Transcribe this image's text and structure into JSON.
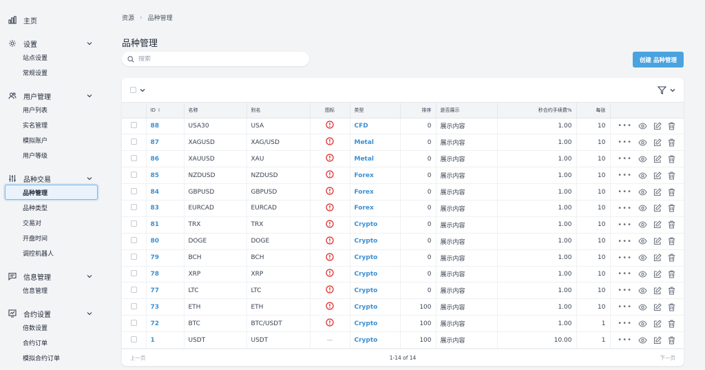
{
  "sidebar": {
    "home": "主页",
    "sections": [
      {
        "label": "设置",
        "items": [
          "站点设置",
          "常规设置"
        ]
      },
      {
        "label": "用户管理",
        "items": [
          "用户列表",
          "实名管理",
          "模拟账户",
          "用户等级"
        ]
      },
      {
        "label": "品种交易",
        "items": [
          "品种管理",
          "品种类型",
          "交易对",
          "开盘时间",
          "调控机器人"
        ]
      },
      {
        "label": "信息管理",
        "items": [
          "信息管理"
        ]
      },
      {
        "label": "合约设置",
        "items": [
          "倍数设置",
          "合约订单",
          "模拟合约订单"
        ]
      }
    ]
  },
  "breadcrumb": {
    "root": "资源",
    "current": "品种管理"
  },
  "page_title": "品种管理",
  "search": {
    "placeholder": "搜索",
    "value": ""
  },
  "create_button": "创建 品种管理",
  "table": {
    "headers": {
      "id": "ID",
      "name": "名称",
      "alias": "别名",
      "icon": "图标",
      "type": "类型",
      "sort": "排序",
      "show": "是否展示",
      "fee": "秒合约手续费%",
      "per": "每张"
    },
    "rows": [
      {
        "id": "88",
        "name": "USA30",
        "alias": "USA",
        "icon": "error",
        "type": "CFD",
        "sort": "0",
        "show": "展示内容",
        "fee": "1.00",
        "per": "10"
      },
      {
        "id": "87",
        "name": "XAGUSD",
        "alias": "XAG/USD",
        "icon": "error",
        "type": "Metal",
        "sort": "0",
        "show": "展示内容",
        "fee": "1.00",
        "per": "10"
      },
      {
        "id": "86",
        "name": "XAUUSD",
        "alias": "XAU",
        "icon": "error",
        "type": "Metal",
        "sort": "0",
        "show": "展示内容",
        "fee": "1.00",
        "per": "10"
      },
      {
        "id": "85",
        "name": "NZDUSD",
        "alias": "NZDUSD",
        "icon": "error",
        "type": "Forex",
        "sort": "0",
        "show": "展示内容",
        "fee": "1.00",
        "per": "10"
      },
      {
        "id": "84",
        "name": "GBPUSD",
        "alias": "GBPUSD",
        "icon": "error",
        "type": "Forex",
        "sort": "0",
        "show": "展示内容",
        "fee": "1.00",
        "per": "10"
      },
      {
        "id": "83",
        "name": "EURCAD",
        "alias": "EURCAD",
        "icon": "error",
        "type": "Forex",
        "sort": "0",
        "show": "展示内容",
        "fee": "1.00",
        "per": "10"
      },
      {
        "id": "81",
        "name": "TRX",
        "alias": "TRX",
        "icon": "error",
        "type": "Crypto",
        "sort": "0",
        "show": "展示内容",
        "fee": "1.00",
        "per": "10"
      },
      {
        "id": "80",
        "name": "DOGE",
        "alias": "DOGE",
        "icon": "error",
        "type": "Crypto",
        "sort": "0",
        "show": "展示内容",
        "fee": "1.00",
        "per": "10"
      },
      {
        "id": "79",
        "name": "BCH",
        "alias": "BCH",
        "icon": "error",
        "type": "Crypto",
        "sort": "0",
        "show": "展示内容",
        "fee": "1.00",
        "per": "10"
      },
      {
        "id": "78",
        "name": "XRP",
        "alias": "XRP",
        "icon": "error",
        "type": "Crypto",
        "sort": "0",
        "show": "展示内容",
        "fee": "1.00",
        "per": "10"
      },
      {
        "id": "77",
        "name": "LTC",
        "alias": "LTC",
        "icon": "error",
        "type": "Crypto",
        "sort": "0",
        "show": "展示内容",
        "fee": "1.00",
        "per": "10"
      },
      {
        "id": "73",
        "name": "ETH",
        "alias": "ETH",
        "icon": "error",
        "type": "Crypto",
        "sort": "100",
        "show": "展示内容",
        "fee": "1.00",
        "per": "10"
      },
      {
        "id": "72",
        "name": "BTC",
        "alias": "BTC/USDT",
        "icon": "error",
        "type": "Crypto",
        "sort": "100",
        "show": "展示内容",
        "fee": "1.00",
        "per": "1"
      },
      {
        "id": "1",
        "name": "USDT",
        "alias": "USDT",
        "icon": "—",
        "type": "Crypto",
        "sort": "100",
        "show": "展示内容",
        "fee": "10.00",
        "per": "1"
      }
    ]
  },
  "pagination": {
    "prev": "上一页",
    "info": "1-14 of 14",
    "next": "下一页"
  },
  "colors": {
    "accent": "#4aa3df",
    "link": "#3b8fd1",
    "error": "#dc2626"
  }
}
